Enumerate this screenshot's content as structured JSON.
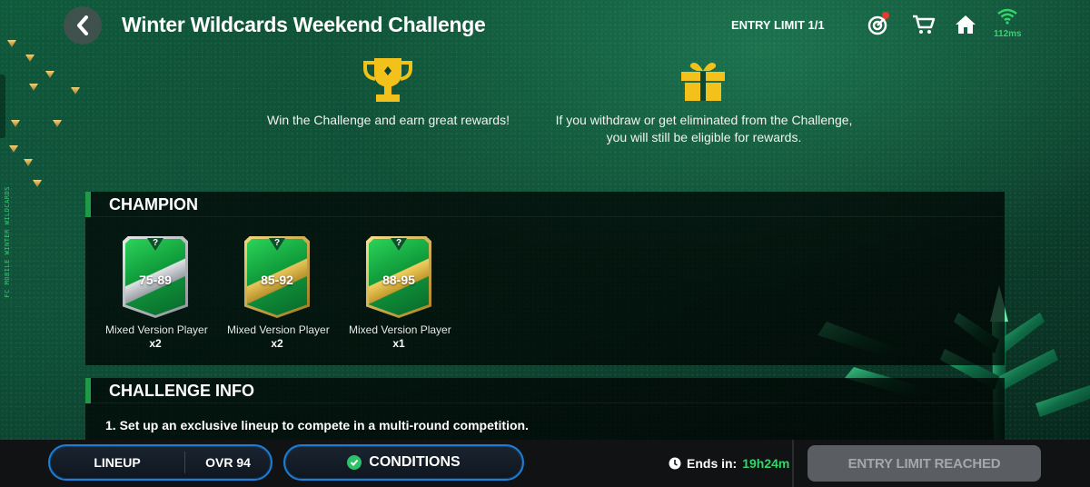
{
  "header": {
    "title": "Winter Wildcards Weekend Challenge",
    "entry_limit": "ENTRY LIMIT 1/1",
    "ping": "112ms"
  },
  "side_text": "FC MOBILE WINTER WILDCARDS",
  "info": [
    {
      "icon": "trophy-icon",
      "text": "Win the Challenge and earn great rewards!"
    },
    {
      "icon": "gift-icon",
      "text": "If you withdraw or get eliminated from the Challenge, you will still be eligible for rewards."
    }
  ],
  "champion": {
    "heading": "CHAMPION",
    "cards": [
      {
        "badge": "?",
        "rating": "75-89",
        "label": "Mixed Version Player",
        "qty": "x2",
        "tier": "silver"
      },
      {
        "badge": "?",
        "rating": "85-92",
        "label": "Mixed Version Player",
        "qty": "x2",
        "tier": "gold"
      },
      {
        "badge": "?",
        "rating": "88-95",
        "label": "Mixed Version Player",
        "qty": "x1",
        "tier": "gold"
      }
    ]
  },
  "challenge_info": {
    "heading": "CHALLENGE INFO",
    "lines": [
      "1. Set up an exclusive lineup to compete in a multi-round competition."
    ]
  },
  "bottom": {
    "lineup_label": "LINEUP",
    "ovr": "OVR 94",
    "conditions_label": "CONDITIONS",
    "ends_label": "Ends in:",
    "ends_value": "19h24m",
    "entry_button": "ENTRY LIMIT REACHED"
  },
  "colors": {
    "accent_green": "#35d46a",
    "blue_border": "#1a7ed6",
    "gold": "#f2c21a"
  }
}
